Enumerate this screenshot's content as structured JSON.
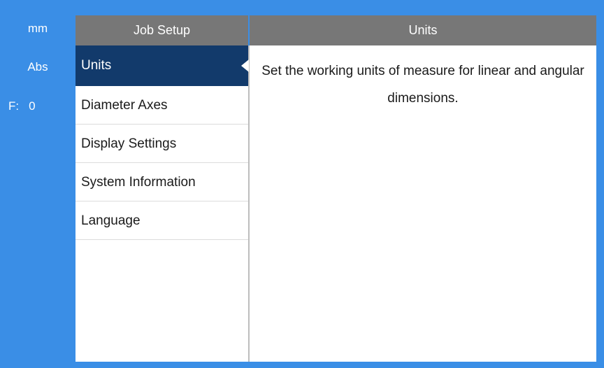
{
  "status": {
    "units": "mm",
    "mode": "Abs",
    "feed_label": "F:",
    "feed_value": "0"
  },
  "menu": {
    "title": "Job Setup",
    "items": [
      {
        "label": "Units",
        "selected": true
      },
      {
        "label": "Diameter Axes",
        "selected": false
      },
      {
        "label": "Display Settings",
        "selected": false
      },
      {
        "label": "System Information",
        "selected": false
      },
      {
        "label": "Language",
        "selected": false
      }
    ]
  },
  "content": {
    "title": "Units",
    "description": "Set the working units of measure for linear and angular dimensions."
  },
  "colors": {
    "background": "#3a8ee6",
    "header": "#777777",
    "selected": "#123a6b"
  }
}
